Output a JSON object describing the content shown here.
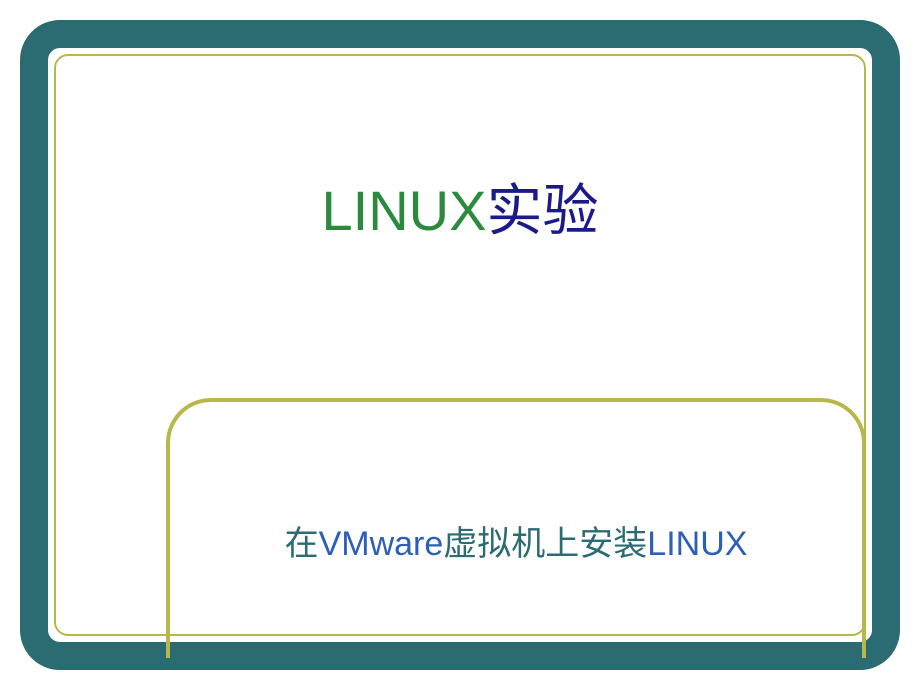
{
  "slide": {
    "title": {
      "en": "LINUX",
      "cn": "实验"
    },
    "subtitle": {
      "cn1": "在",
      "en1": "VMware",
      "cn2": "虚拟机上安装",
      "en2": "LINUX"
    }
  }
}
